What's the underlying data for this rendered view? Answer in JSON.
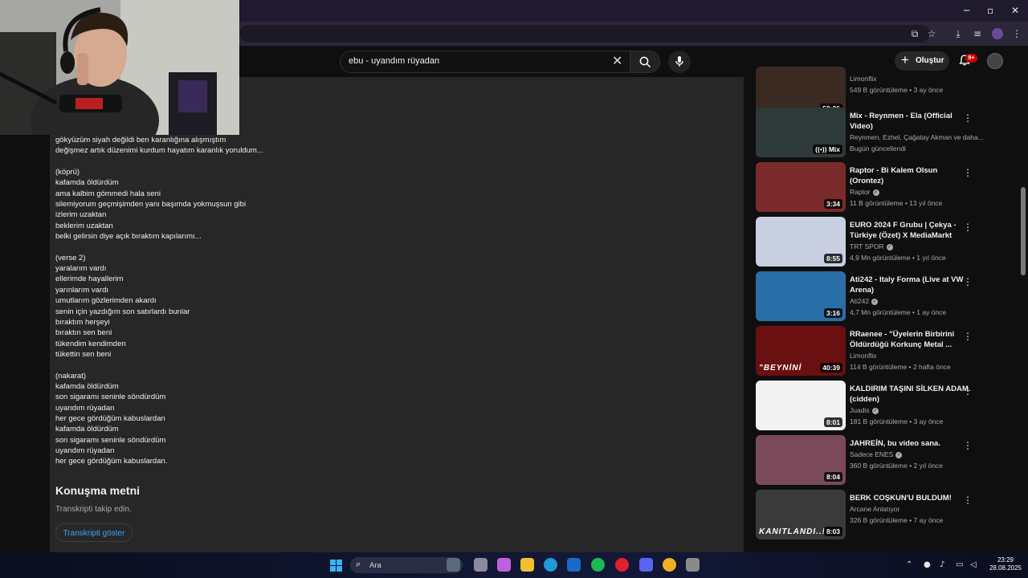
{
  "window": {
    "minimize": "─",
    "maximize": "▫",
    "close": "✕"
  },
  "search": {
    "query": "ebu - uyandım rüyadan"
  },
  "header": {
    "create_label": "Oluştur",
    "notification_count": "9+"
  },
  "description": {
    "lyrics": [
      "gökyüzüm siyah değildi ben karanlığına alışmıştım",
      "değişmez artık düzenimi kurdum hayatım karanlık yoruldum...",
      "",
      "(köprü)",
      "kafamda öldürdüm",
      "ama kalbim gömmedi hala seni",
      "silemiyorum geçmişimden yanı başımda yokmuşsun gibi",
      "izlerim uzaktan",
      "beklerim uzaktan",
      "belki gelirsin diye açık bıraktım kapılarımı...",
      "",
      "(verse 2)",
      "yaralarım vardı",
      "ellerimde hayallerim",
      "yarınlarım vardı",
      "umutlarım gözlerimden akardı",
      "senin için yazdığım son satırlardı bunlar",
      "bıraktım herşeyi",
      "bıraktın sen beni",
      "tükendim kendimden",
      "tükettin sen beni",
      "",
      "(nakarat)",
      "kafamda öldürdüm",
      "son sigaramı seninle söndürdüm",
      "uyandım rüyadan",
      "her gece gördüğüm kabuslardan",
      "kafamda öldürdüm",
      "son sigaramı seninle söndürdüm",
      "uyandım rüyadan",
      "her gece gördüğüm kabuslardan."
    ],
    "transcript_title": "Konuşma metni",
    "transcript_subtitle": "Transkripti takip edin.",
    "transcript_button": "Transkripti göster"
  },
  "related": [
    {
      "title": "",
      "channel": "Limonflix",
      "verified": false,
      "meta": "549 B görüntüleme • 3 ay önce",
      "duration": "50:36",
      "thumb_color": "#3a2a22"
    },
    {
      "title": "Mix - Reynmen - Ela (Official Video)",
      "channel": "Reynmen, Ezhel, Çağatay Akman ve daha...",
      "verified": false,
      "meta": "Bugün güncellendi",
      "duration": "((•)) Mix",
      "thumb_color": "#2e3a3a"
    },
    {
      "title": "Raptor - Bi Kalem Olsun (Orontez)",
      "channel": "Raptor",
      "verified": true,
      "meta": "11 B görüntüleme • 13 yıl önce",
      "duration": "3:34",
      "thumb_color": "#7a2a2a"
    },
    {
      "title": "EURO 2024 F Grubu | Çekya - Türkiye (Özet) X MediaMarkt",
      "channel": "TRT SPOR",
      "verified": true,
      "meta": "4,9 Mn görüntüleme • 1 yıl önce",
      "duration": "8:55",
      "thumb_color": "#c8cfe0"
    },
    {
      "title": "Ati242 - Italy Forma (Live at VW Arena)",
      "channel": "Ati242",
      "verified": true,
      "meta": "4,7 Mn görüntüleme • 1 ay önce",
      "duration": "3:16",
      "thumb_color": "#2a6ea8"
    },
    {
      "title": "RRaenee - \"Üyelerin Birbirini Öldürdüğü Korkunç Metal ...",
      "channel": "Limonflix",
      "verified": false,
      "meta": "114 B görüntüleme • 2 hafta önce",
      "duration": "40:39",
      "thumb_color": "#6a1010",
      "thumb_text": "\"BEYNİNİ"
    },
    {
      "title": "KALDIRIM TAŞINI SİLKEN ADAM. (cidden)",
      "channel": "Juadis",
      "verified": true,
      "meta": "181 B görüntüleme • 3 ay önce",
      "duration": "8:01",
      "thumb_color": "#f2f2f2"
    },
    {
      "title": "JAHREİN, bu video sana.",
      "channel": "Sadece ENES",
      "verified": true,
      "meta": "360 B görüntüleme • 2 yıl önce",
      "duration": "8:04",
      "thumb_color": "#7a4a5a"
    },
    {
      "title": "BERK COŞKUN'U BULDUM!",
      "channel": "Arcane Anlatıyor",
      "verified": false,
      "meta": "326 B görüntüleme • 7 ay önce",
      "duration": "8:03",
      "thumb_color": "#3a3a3a",
      "thumb_text": "KANITLANDI..!"
    }
  ],
  "taskbar": {
    "search_label": "Ara",
    "time": "23:29",
    "date": "28.08.2025",
    "apps": [
      {
        "name": "widget",
        "color": "#5a6a7a"
      },
      {
        "name": "task-view",
        "color": "#8a8a9a"
      },
      {
        "name": "copilot",
        "color": "#c060e0"
      },
      {
        "name": "file-explorer",
        "color": "#f0c030"
      },
      {
        "name": "edge",
        "color": "#1e9ad8"
      },
      {
        "name": "outlook",
        "color": "#1a6ac8"
      },
      {
        "name": "spotify",
        "color": "#1db954"
      },
      {
        "name": "opera",
        "color": "#e02030"
      },
      {
        "name": "discord",
        "color": "#5865f2"
      },
      {
        "name": "chrome",
        "color": "#f0b020"
      },
      {
        "name": "settings",
        "color": "#8a8a8a"
      }
    ]
  }
}
